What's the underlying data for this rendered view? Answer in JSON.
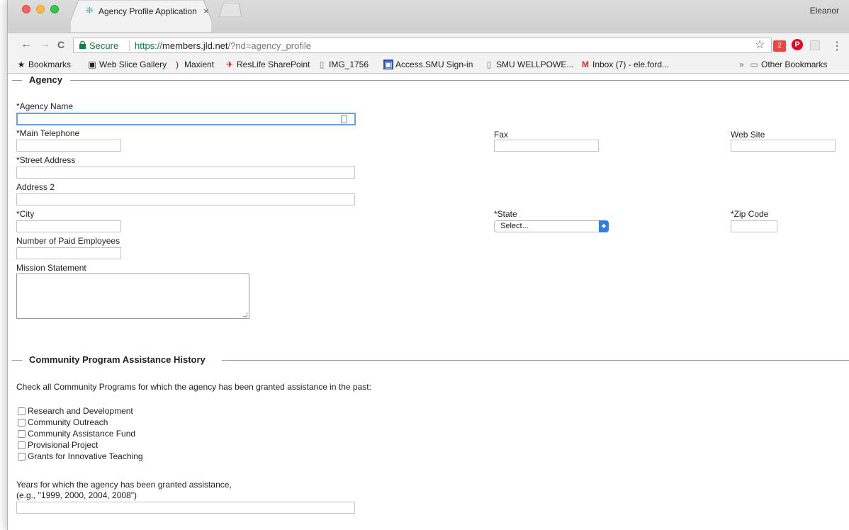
{
  "browser": {
    "tab_title": "Agency Profile Application",
    "tab_close": "×",
    "user": "Eleanor",
    "secure_label": "Secure",
    "url_scheme": "https://",
    "url_host": "members.jld.net",
    "url_path": "/?nd=agency_profile",
    "back": "←",
    "forward": "→",
    "reload": "C",
    "star": "☆",
    "menu": "⋮"
  },
  "bookmarks": [
    {
      "label": "Bookmarks",
      "icon": "★"
    },
    {
      "label": "Web Slice Gallery",
      "icon": "▣"
    },
    {
      "label": "Maxient",
      "icon": ")"
    },
    {
      "label": "ResLife SharePoint",
      "icon": "✈"
    },
    {
      "label": "IMG_1756",
      "icon": "▯"
    },
    {
      "label": "Access.SMU Sign-in",
      "icon": "▣"
    },
    {
      "label": "SMU WELLPOWE...",
      "icon": "▯"
    },
    {
      "label": "Inbox (7) - ele.ford...",
      "icon": "M"
    }
  ],
  "bookmarks_overflow": "»",
  "other_bookmarks": "Other Bookmarks",
  "agency": {
    "legend": "Agency",
    "agency_name": "*Agency Name",
    "main_telephone": "*Main Telephone",
    "fax": "Fax",
    "web_site": "Web Site",
    "street_address": "*Street Address",
    "address2": "Address 2",
    "city": "*City",
    "state": "*State",
    "state_selected": "Select...",
    "zip": "*Zip Code",
    "paid_employees": "Number of Paid Employees",
    "mission": "Mission Statement"
  },
  "history": {
    "legend": "Community Program Assistance History",
    "instruction": "Check all Community Programs for which the agency has been granted assistance in the past:",
    "programs": [
      "Research and Development",
      "Community Outreach",
      "Community Assistance Fund",
      "Provisional Project",
      "Grants for Innovative Teaching"
    ],
    "years_label_1": "Years for which the agency has been granted assistance,",
    "years_label_2": "(e.g., \"1999, 2000, 2004, 2008\")"
  }
}
